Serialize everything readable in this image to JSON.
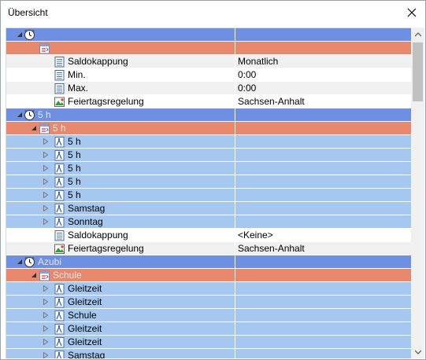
{
  "window": {
    "title": "Übersicht"
  },
  "rows": [
    {
      "kind": "group",
      "depth": 0,
      "expander": "expanded",
      "icon": "clock-icon",
      "name": "",
      "value": ""
    },
    {
      "kind": "sub",
      "depth": 1,
      "expander": "none",
      "icon": "calendar-icon",
      "name": "",
      "value": ""
    },
    {
      "kind": "alt",
      "depth": 2,
      "expander": "none",
      "icon": "property-sheet-icon",
      "name": "Saldokappung",
      "value": "Monatlich"
    },
    {
      "kind": "white",
      "depth": 2,
      "expander": "none",
      "icon": "property-sheet-icon",
      "name": "Min.",
      "value": "0:00"
    },
    {
      "kind": "alt",
      "depth": 2,
      "expander": "none",
      "icon": "property-sheet-icon",
      "name": "Max.",
      "value": "0:00"
    },
    {
      "kind": "white",
      "depth": 2,
      "expander": "none",
      "icon": "holiday-map-icon",
      "name": "Feiertagsregelung",
      "value": "Sachsen-Anhalt"
    },
    {
      "kind": "group",
      "depth": 0,
      "expander": "expanded",
      "icon": "clock-icon",
      "name": "5 h",
      "value": ""
    },
    {
      "kind": "sub",
      "depth": 1,
      "expander": "expanded",
      "icon": "calendar-icon",
      "name": "5 h",
      "value": ""
    },
    {
      "kind": "item",
      "depth": 2,
      "expander": "collapsed",
      "icon": "day-profile-icon",
      "name": "5 h",
      "value": ""
    },
    {
      "kind": "item",
      "depth": 2,
      "expander": "collapsed",
      "icon": "day-profile-icon",
      "name": "5 h",
      "value": ""
    },
    {
      "kind": "item",
      "depth": 2,
      "expander": "collapsed",
      "icon": "day-profile-icon",
      "name": "5 h",
      "value": ""
    },
    {
      "kind": "item",
      "depth": 2,
      "expander": "collapsed",
      "icon": "day-profile-icon",
      "name": "5 h",
      "value": ""
    },
    {
      "kind": "item",
      "depth": 2,
      "expander": "collapsed",
      "icon": "day-profile-icon",
      "name": "5 h",
      "value": ""
    },
    {
      "kind": "item",
      "depth": 2,
      "expander": "collapsed",
      "icon": "day-profile-icon",
      "name": "Samstag",
      "value": ""
    },
    {
      "kind": "item",
      "depth": 2,
      "expander": "collapsed",
      "icon": "day-profile-icon",
      "name": "Sonntag",
      "value": ""
    },
    {
      "kind": "white",
      "depth": 2,
      "expander": "none",
      "icon": "property-sheet-icon",
      "name": "Saldokappung",
      "value": "<Keine>"
    },
    {
      "kind": "alt",
      "depth": 2,
      "expander": "none",
      "icon": "holiday-map-icon",
      "name": "Feiertagsregelung",
      "value": "Sachsen-Anhalt"
    },
    {
      "kind": "group",
      "depth": 0,
      "expander": "expanded",
      "icon": "clock-icon",
      "name": "Azubi",
      "value": ""
    },
    {
      "kind": "sub",
      "depth": 1,
      "expander": "expanded",
      "icon": "calendar-icon",
      "name": "Schule",
      "value": ""
    },
    {
      "kind": "item",
      "depth": 2,
      "expander": "collapsed",
      "icon": "day-profile-icon",
      "name": "Gleitzeit",
      "value": ""
    },
    {
      "kind": "item",
      "depth": 2,
      "expander": "collapsed",
      "icon": "day-profile-icon",
      "name": "Gleitzeit",
      "value": ""
    },
    {
      "kind": "item",
      "depth": 2,
      "expander": "collapsed",
      "icon": "day-profile-icon",
      "name": "Schule",
      "value": ""
    },
    {
      "kind": "item",
      "depth": 2,
      "expander": "collapsed",
      "icon": "day-profile-icon",
      "name": "Gleitzeit",
      "value": ""
    },
    {
      "kind": "item",
      "depth": 2,
      "expander": "collapsed",
      "icon": "day-profile-icon",
      "name": "Gleitzeit",
      "value": ""
    },
    {
      "kind": "item",
      "depth": 2,
      "expander": "collapsed",
      "icon": "day-profile-icon",
      "name": "Samstag",
      "value": ""
    }
  ],
  "colors": {
    "group": "#6f8fe3",
    "sub": "#e8896e",
    "item": "#a5c7f0",
    "alt": "#f0f0f0"
  },
  "scrollbar": {
    "icons": [
      "scroll-up-arrow-icon",
      "scroll-down-arrow-icon"
    ]
  }
}
